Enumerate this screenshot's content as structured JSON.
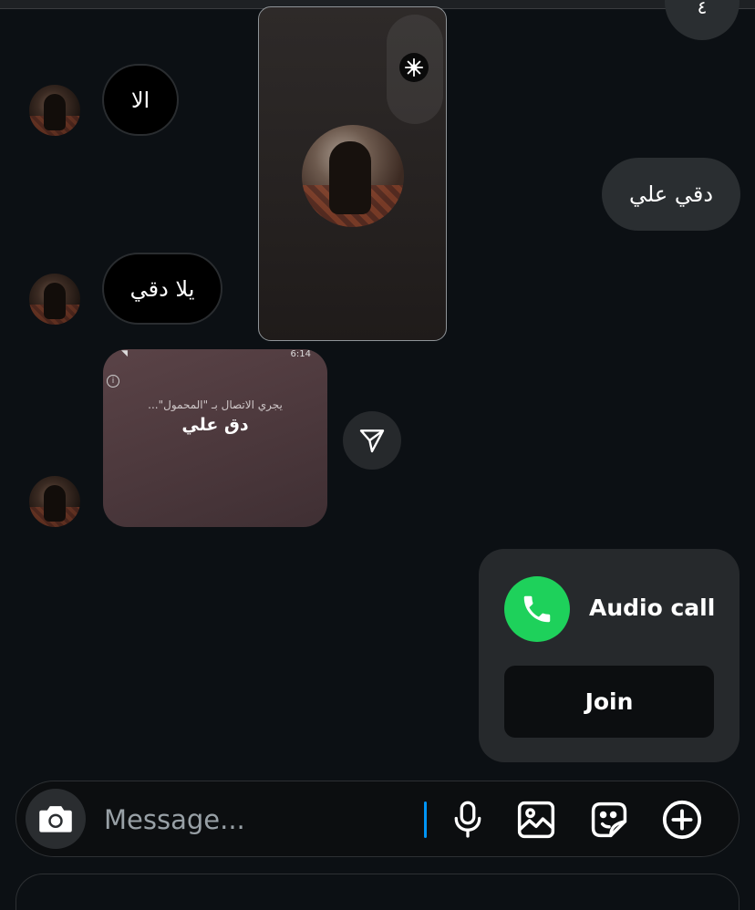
{
  "messages": {
    "top_partial": "٤",
    "msg_1": "الا",
    "msg_2": "دقي علي",
    "msg_3": "يلا دقي",
    "screenshot": {
      "time": "6:14",
      "calling_text": "يجري الاتصال بـ \"المحمول\"...",
      "contact_name": "دق علي"
    }
  },
  "call_card": {
    "title": "Audio call",
    "join_label": "Join"
  },
  "composer": {
    "placeholder": "Message..."
  },
  "colors": {
    "background": "#0c1014",
    "bubble_outgoing": "#2a2e31",
    "call_green": "#1ed15b",
    "caret_blue": "#0095f6"
  }
}
